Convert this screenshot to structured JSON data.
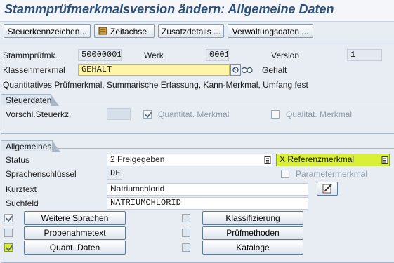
{
  "title": "Stammprüfmerkmalsversion ändern: Allgemeine Daten",
  "toolbar": {
    "steuerkennzeichen": "Steuerkennzeichen...",
    "zeitachse": "Zeitachse",
    "zusatzdetails": "Zusatzdetails ...",
    "verwaltungsdaten": "Verwaltungsdaten ..."
  },
  "header": {
    "stammpruefmk_label": "Stammprüfmk.",
    "stammpruefmk_value": "50000001",
    "werk_label": "Werk",
    "werk_value": "0001",
    "version_label": "Version",
    "version_value": "1",
    "klassenmerkmal_label": "Klassenmerkmal",
    "klassenmerkmal_value": "GEHALT",
    "klassenmerkmal_text": "Gehalt",
    "description": "Quantitatives Prüfmerkmal, Summarische Erfassung, Kann-Merkmal, Umfang fest"
  },
  "steuerdaten": {
    "title": "Steuerdaten",
    "vorschl_label": "Vorschl.Steuerkz.",
    "quantitat_label": "Quantitat. Merkmal",
    "quantitat_checked": true,
    "qualitat_label": "Qualitat. Merkmal",
    "qualitat_checked": false
  },
  "allgemeines": {
    "title": "Allgemeines",
    "status_label": "Status",
    "status_value": "2 Freigegeben",
    "referenz_value": "X Referenzmerkmal",
    "sprachenschluessel_label": "Sprachenschlüssel",
    "sprachenschluessel_value": "DE",
    "parametermerkmal_label": "Parametermerkmal",
    "kurztext_label": "Kurztext",
    "kurztext_value": "Natriumchlorid",
    "suchfeld_label": "Suchfeld",
    "suchfeld_value": "NATRIUMCHLORID"
  },
  "buttons": {
    "weitere_sprachen": "Weitere Sprachen",
    "probenahmetext": "Probenahmetext",
    "quant_daten": "Quant. Daten",
    "klassifizierung": "Klassifizierung",
    "pruefmethoden": "Prüfmethoden",
    "kataloge": "Kataloge"
  },
  "colors": {
    "title": "#2b4f7a",
    "highlight": "#d9f035",
    "required_field": "#fff5a8"
  }
}
